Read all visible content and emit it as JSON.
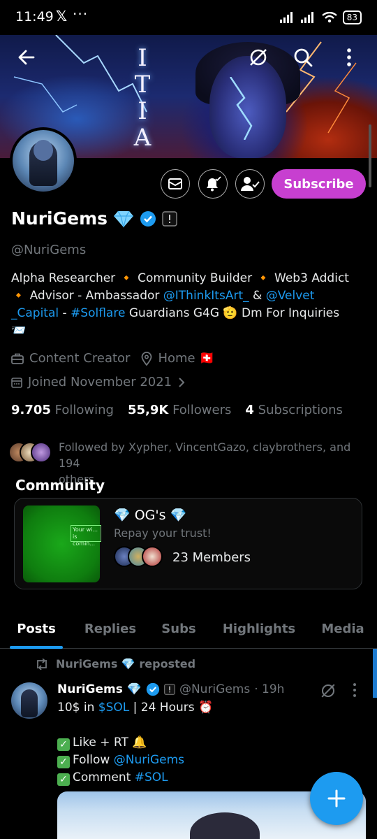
{
  "status_bar": {
    "time": "11:49",
    "x_icon": "𝕏",
    "dots": "···",
    "battery": "83"
  },
  "banner": {
    "letters": [
      "I",
      "T",
      "I",
      "A"
    ]
  },
  "profile": {
    "display_name": "NuriGems",
    "handle": "@NuriGems",
    "subscribe_label": "Subscribe",
    "bio": {
      "line1": "Alpha Researcher 🔸 Community Builder 🔸 Web3 Addict",
      "line2_prefix": "🔸 Advisor  - Ambassador ",
      "mention1": "@IThinkItsArt_",
      "line2_amp": " & ",
      "mention2a": "@Velvet",
      "mention2b": "_Capital",
      "line3_dash": " - ",
      "hashtag": "#Solflare",
      "line3_rest": " Guardians G4G 🫡  Dm For Inquiries",
      "line4": "📨"
    },
    "category": "Content Creator",
    "location": "Home 🇨🇭",
    "joined": "Joined November 2021",
    "stats": {
      "following_count": "9.705",
      "following_label": "Following",
      "followers_count": "55,9K",
      "followers_label": "Followers",
      "subscriptions_count": "4",
      "subscriptions_label": "Subscriptions"
    },
    "followed_by_line1": "Followed by Xypher, VincentGazo, claybrothers, and 194",
    "followed_by_line2": "others"
  },
  "community": {
    "section_title": "Community",
    "name": "💎 OG's 💎",
    "description": "Repay your trust!",
    "members": "23 Members",
    "sign_text": "Your wi... is comin..."
  },
  "tabs": [
    {
      "label": "Posts",
      "active": true
    },
    {
      "label": "Replies",
      "active": false
    },
    {
      "label": "Subs",
      "active": false
    },
    {
      "label": "Highlights",
      "active": false
    },
    {
      "label": "Media",
      "active": false
    }
  ],
  "post": {
    "repost_label": "NuriGems 💎 reposted",
    "author_name": "NuriGems 💎",
    "author_handle": "@NuriGems",
    "time": "· 19h",
    "line1_prefix": "10$ in ",
    "line1_cashtag": "$SOL",
    "line1_rest": " | 24 Hours ⏰",
    "line3": "Like + RT 🔔",
    "line4_prefix": "Follow ",
    "line4_mention": "@NuriGems",
    "line5_prefix": "Comment ",
    "line5_hashtag": "#SOL"
  },
  "colors": {
    "accent": "#1d9bf0",
    "subscribe": "#c73fd0",
    "muted": "#71767b"
  },
  "icons": [
    "back-arrow-icon",
    "grok-icon",
    "search-icon",
    "more-vertical-icon",
    "mail-icon",
    "bell-icon",
    "follow-person-icon",
    "verified-badge-icon",
    "briefcase-icon",
    "location-pin-icon",
    "calendar-icon",
    "repost-icon",
    "plus-icon"
  ]
}
